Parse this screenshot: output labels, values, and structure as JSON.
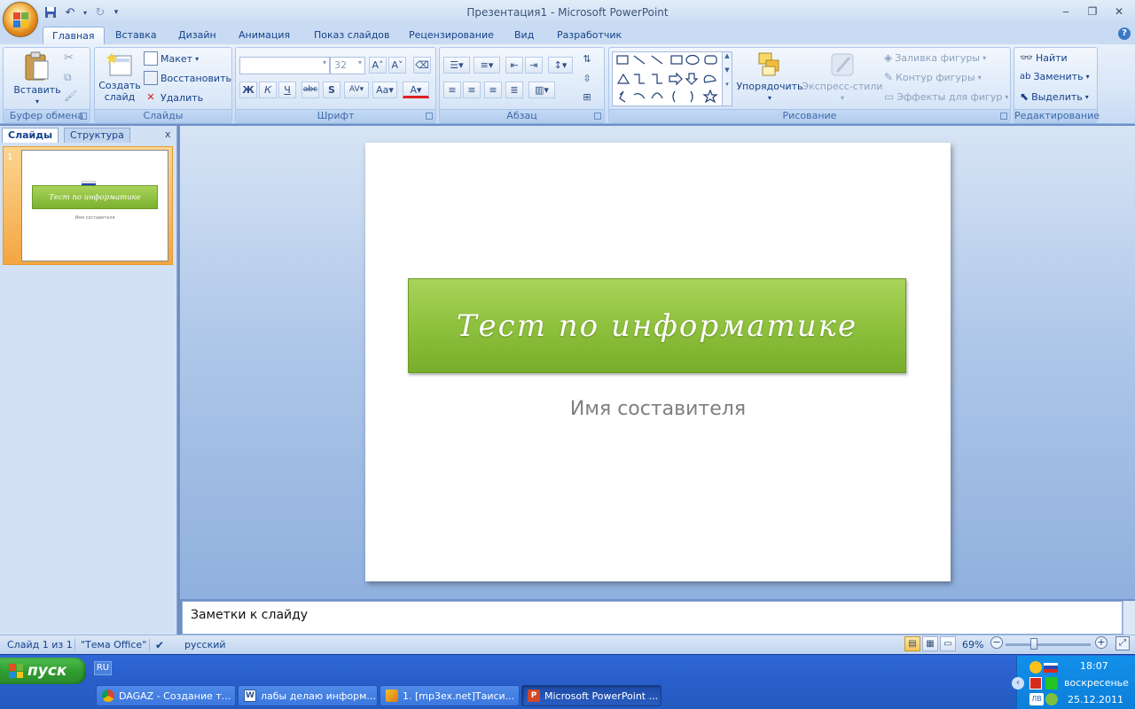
{
  "window": {
    "title": "Презентация1 - Microsoft PowerPoint",
    "controls": [
      "minimize-icon",
      "restore-icon",
      "close-icon"
    ]
  },
  "qat": {
    "icons": [
      "save-icon",
      "undo-icon",
      "redo-icon",
      "customize-icon"
    ]
  },
  "tabs": [
    {
      "label": "Главная",
      "active": true
    },
    {
      "label": "Вставка"
    },
    {
      "label": "Дизайн"
    },
    {
      "label": "Анимация"
    },
    {
      "label": "Показ слайдов"
    },
    {
      "label": "Рецензирование"
    },
    {
      "label": "Вид"
    },
    {
      "label": "Разработчик"
    }
  ],
  "ribbon": {
    "clipboard": {
      "label": "Буфер обмена",
      "paste": "Вставить"
    },
    "slides": {
      "label": "Слайды",
      "create_line1": "Создать",
      "create_line2": "слайд",
      "layout": "Макет",
      "reset": "Восстановить",
      "delete": "Удалить"
    },
    "font": {
      "label": "Шрифт",
      "font_name": "",
      "font_size": "32"
    },
    "paragraph": {
      "label": "Абзац"
    },
    "drawing": {
      "label": "Рисование",
      "arrange": "Упорядочить",
      "quick_styles": "Экспресс-стили",
      "fill": "Заливка фигуры",
      "outline": "Контур фигуры",
      "effects": "Эффекты для фигур"
    },
    "editing": {
      "label": "Редактирование",
      "find": "Найти",
      "replace": "Заменить",
      "select": "Выделить"
    }
  },
  "panel": {
    "tab_slides": "Слайды",
    "tab_outline": "Структура",
    "close": "x",
    "thumb_number": "1"
  },
  "slide": {
    "title": "Тест по информатике",
    "subtitle": "Имя составителя",
    "title_color": "#8cbf3b"
  },
  "notes": {
    "placeholder": "Заметки к слайду"
  },
  "status": {
    "slide_count": "Слайд 1 из 1",
    "theme": "\"Тема Office\"",
    "language": "русский",
    "zoom": "69%"
  },
  "taskbar": {
    "start": "пуск",
    "lang": "RU",
    "tasks": [
      {
        "label": "DAGAZ - Создание т...",
        "icon": "chrome-icon"
      },
      {
        "label": "лабы делаю информ...",
        "icon": "word-icon"
      },
      {
        "label": "1. [mp3ex.net]Таиси...",
        "icon": "winamp-icon"
      },
      {
        "label": "Microsoft PowerPoint ...",
        "icon": "powerpoint-icon",
        "active": true
      }
    ],
    "clock": "18:07",
    "day": "воскресенье",
    "date": "25.12.2011"
  }
}
